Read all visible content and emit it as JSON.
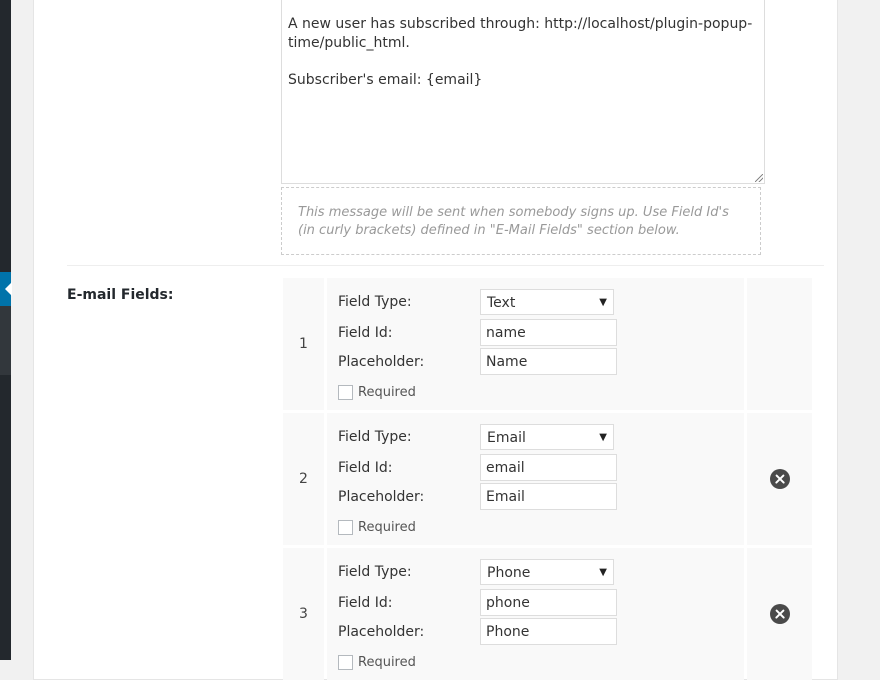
{
  "notification": {
    "message_line1": "A new user has subscribed through: http://localhost/plugin-popup-time/public_html.",
    "message_line2": "Subscriber's email: {email}",
    "help_text": "This message will be sent when somebody signs up. Use Field Id's (in curly brackets) defined in \"E-Mail Fields\" section below."
  },
  "email_fields": {
    "section_label": "E-mail Fields:",
    "labels": {
      "field_type": "Field Type:",
      "field_id": "Field Id:",
      "placeholder": "Placeholder:",
      "required": "Required"
    },
    "rows": [
      {
        "num": "1",
        "type": "Text",
        "id": "name",
        "placeholder": "Name",
        "required": false,
        "removable": false
      },
      {
        "num": "2",
        "type": "Email",
        "id": "email",
        "placeholder": "Email",
        "required": false,
        "removable": true
      },
      {
        "num": "3",
        "type": "Phone",
        "id": "phone",
        "placeholder": "Phone",
        "required": false,
        "removable": true
      }
    ]
  },
  "icons": {
    "remove": "close-circle-icon",
    "select_arrow": "caret-down-icon",
    "menu_arrow": "menu-arrow-icon"
  }
}
